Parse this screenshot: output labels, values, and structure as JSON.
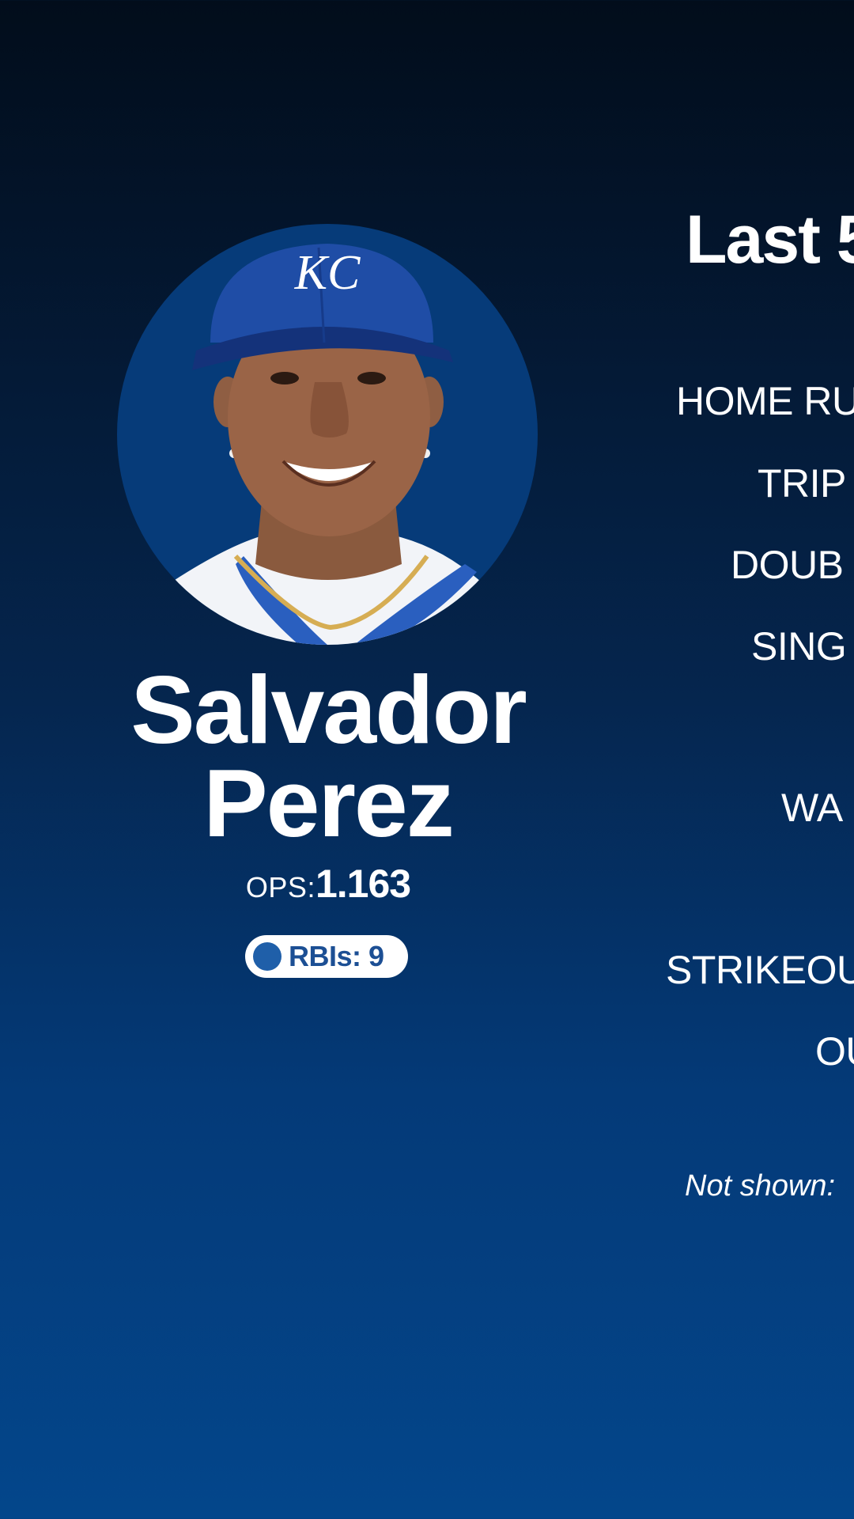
{
  "player": {
    "first_name": "Salvador",
    "last_name": "Perez",
    "ops_label": "OPS:",
    "ops_value": "1.163",
    "rbi_label": "RBIs: 9",
    "cap_logo": "KC"
  },
  "stats": {
    "title": "Last 5",
    "rows": [
      "HOME RU",
      "TRIP",
      "DOUB",
      "SING",
      "WA",
      "STRIKEOU",
      "OU"
    ],
    "footnote": "Not shown:"
  },
  "colors": {
    "background_top": "#020d1b",
    "background_bottom": "#03468b",
    "avatar_bg": "#063b79",
    "badge_text": "#1c4f94",
    "badge_dot": "#1f5fa9"
  }
}
